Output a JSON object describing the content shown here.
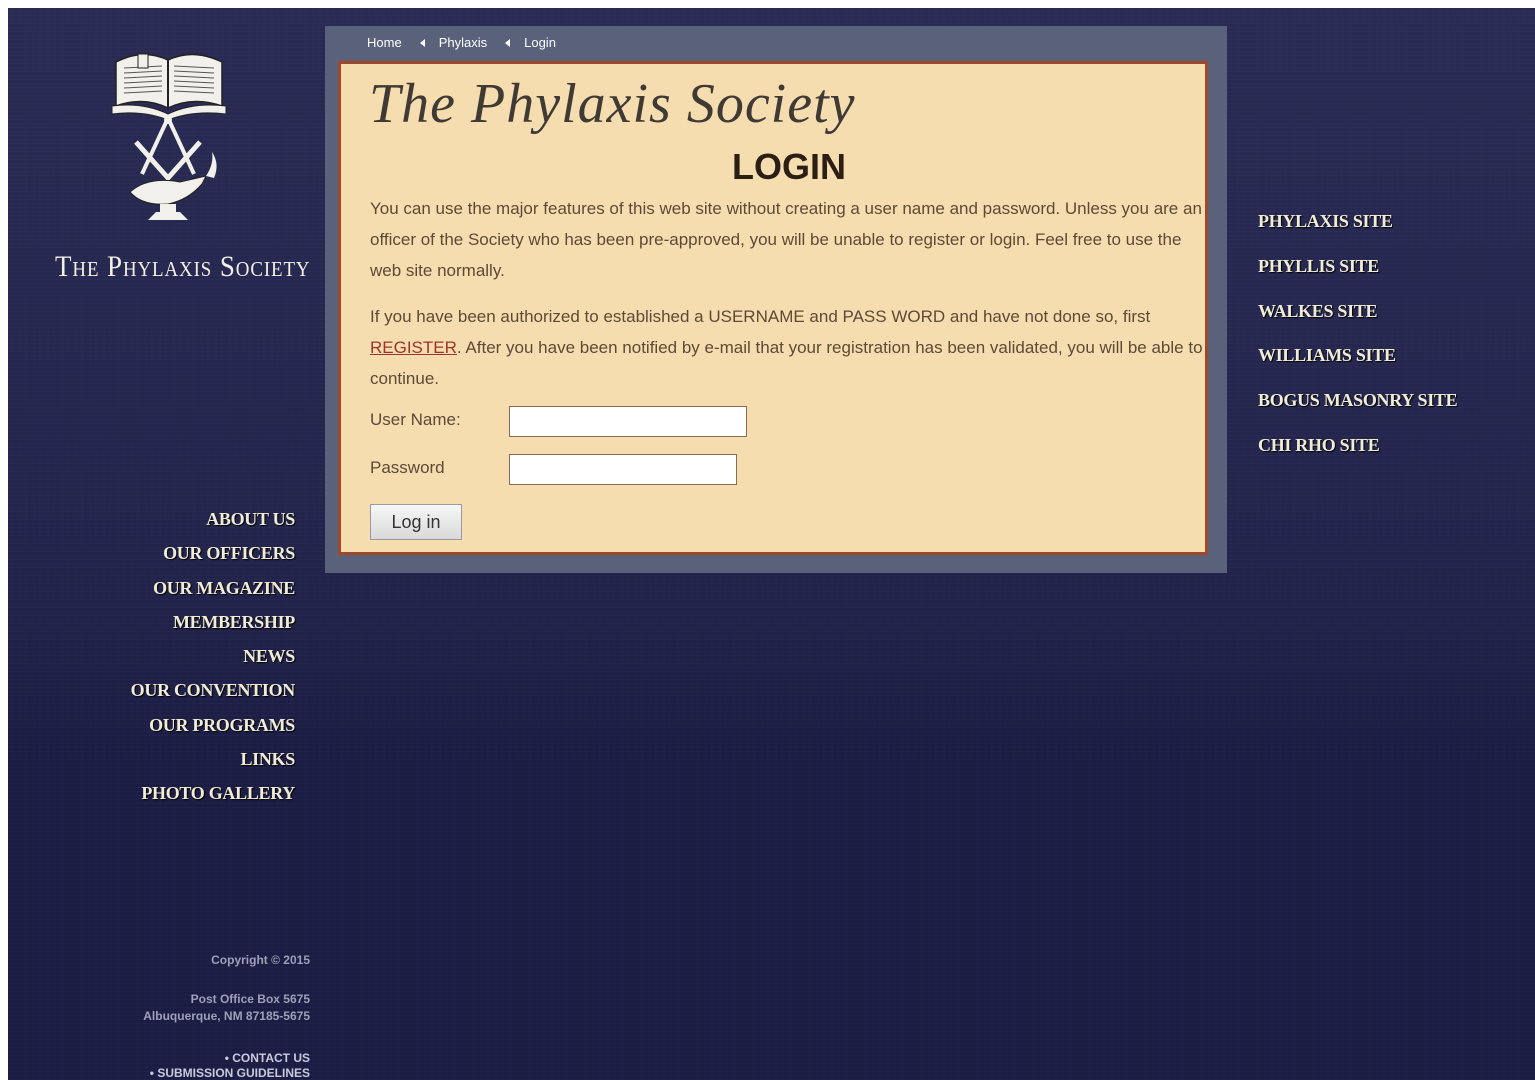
{
  "colors": {
    "page_background": "#1c1d45",
    "panel_frame": "#59627a",
    "content_background": "#f6ddb0",
    "content_border": "#9e4a2a",
    "nav_text": "#f1ecd6",
    "body_text": "#5e4935",
    "link": "#9e3428"
  },
  "logo": {
    "emblem_icon": "open-bible-square-compass-lamp-emblem",
    "wordmark": "The Phylaxis Society"
  },
  "breadcrumb": {
    "items": [
      "Home",
      "Phylaxis",
      "Login"
    ],
    "separator_icon": "left-triangle-icon"
  },
  "content": {
    "site_title": "The Phylaxis Society",
    "heading": "LOGIN",
    "para1": "You can use the major features of this web site without creating a user name and password. Unless you are an officer of the Society who has been pre-approved, you will be unable to register or login. Feel free to use the web site normally.",
    "para2_before": "If you have been authorized to established a USERNAME and PASS WORD and have not done so, first ",
    "register_link": "REGISTER",
    "para2_after": ". After you have been notified by e-mail that your registration has been validated, you will be able to continue."
  },
  "form": {
    "username_label": "User Name:",
    "username_value": "",
    "password_label": "Password",
    "password_value": "",
    "login_button": "Log in"
  },
  "left_nav": [
    "ABOUT US",
    "OUR OFFICERS",
    "OUR MAGAZINE",
    "MEMBERSHIP",
    "NEWS",
    "OUR CONVENTION",
    "OUR PROGRAMS",
    "LINKS",
    "PHOTO GALLERY"
  ],
  "right_nav": [
    "PHYLAXIS SITE",
    "PHYLLIS SITE",
    "WALKES SITE",
    "WILLIAMS SITE",
    "BOGUS MASONRY SITE",
    "CHI RHO SITE"
  ],
  "footer": {
    "copyright": "Copyright © 2015",
    "address_line1": "Post Office Box 5675",
    "address_line2": "Albuquerque, NM 87185-5675",
    "contact": "• CONTACT US",
    "submission": "• SUBMISSION GUIDELINES"
  }
}
